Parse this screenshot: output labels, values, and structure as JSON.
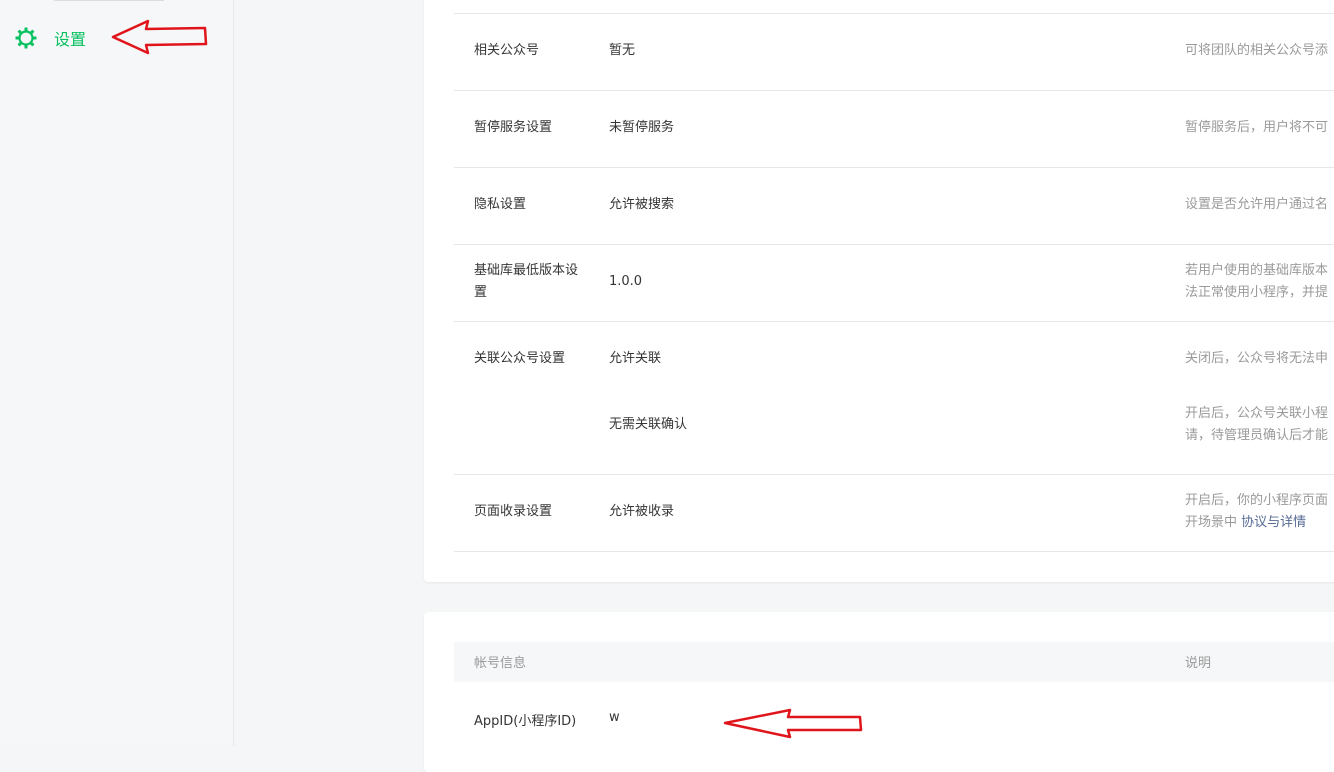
{
  "sidebar": {
    "settings_label": "设置"
  },
  "settings": {
    "rows": [
      {
        "label": "相关公众号",
        "value": "暂无",
        "desc": "可将团队的相关公众号添"
      },
      {
        "label": "暂停服务设置",
        "value": "未暂停服务",
        "desc": "暂停服务后，用户将不可"
      },
      {
        "label": "隐私设置",
        "value": "允许被搜索",
        "desc": "设置是否允许用户通过名"
      },
      {
        "label": "基础库最低版本设",
        "label2": "置",
        "value": "1.0.0",
        "desc": "若用户使用的基础库版本",
        "desc2": "法正常使用小程序，并提"
      },
      {
        "label": "关联公众号设置",
        "value": "允许关联",
        "desc": "关闭后，公众号将无法申"
      },
      {
        "value": "无需关联确认",
        "desc": "开启后，公众号关联小程",
        "desc2": "请，待管理员确认后才能"
      },
      {
        "label": "页面收录设置",
        "value": "允许被收录",
        "desc": "开启后，你的小程序页面",
        "desc2_prefix": "开场景中 ",
        "desc2_link": "协议与详情"
      }
    ]
  },
  "account": {
    "header_label": "帐号信息",
    "header_desc": "说明",
    "appid_label": "AppID(小程序ID)",
    "appid_value": "w"
  },
  "colors": {
    "accent": "#07c160",
    "annotation": "#e0151b",
    "link": "#576b95"
  },
  "icons": {
    "settings": "gear-icon"
  }
}
